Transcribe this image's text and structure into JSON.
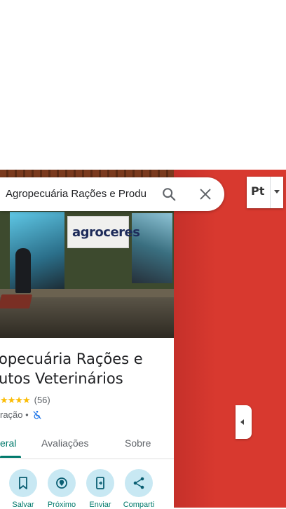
{
  "search": {
    "query": "Agropecuária Rações e Produ"
  },
  "language_button": {
    "label": "Pt"
  },
  "place": {
    "title_line1": "opecuária Rações e",
    "title_line2": "utos Veterinários",
    "stars": "★★★★",
    "rating_count": "(56)",
    "category": "ração",
    "separator": " •",
    "photo_sign": "agroceres"
  },
  "tabs": [
    {
      "label": "eral"
    },
    {
      "label": "Avaliações"
    },
    {
      "label": "Sobre"
    }
  ],
  "actions": [
    {
      "label": "Salvar",
      "icon": "bookmark-icon"
    },
    {
      "label": "Próximo",
      "icon": "nearby-icon"
    },
    {
      "label": "Enviar",
      "icon": "send-to-phone-icon"
    },
    {
      "label": "Comparti",
      "icon": "share-icon"
    }
  ],
  "colors": {
    "accent": "#00796b",
    "map": "#d8392f",
    "action_bg": "#c8e8f3",
    "star": "#fbbc04"
  }
}
